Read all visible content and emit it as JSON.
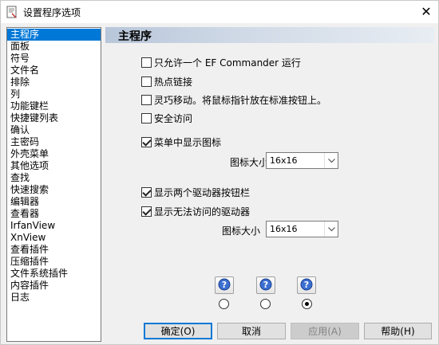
{
  "window": {
    "title": "设置程序选项",
    "icon": "settings-doc-icon"
  },
  "sidebar": {
    "items": [
      {
        "label": "主程序",
        "selected": true
      },
      {
        "label": "面板"
      },
      {
        "label": "符号"
      },
      {
        "label": "文件名"
      },
      {
        "label": "排除"
      },
      {
        "label": "列"
      },
      {
        "label": "功能键栏"
      },
      {
        "label": "快捷键列表"
      },
      {
        "label": "确认"
      },
      {
        "label": "主密码"
      },
      {
        "label": "外壳菜单"
      },
      {
        "label": "其他选项"
      },
      {
        "label": "查找"
      },
      {
        "label": "快速搜索"
      },
      {
        "label": "编辑器"
      },
      {
        "label": "查看器"
      },
      {
        "label": "IrfanView"
      },
      {
        "label": "XnView"
      },
      {
        "label": "查看插件"
      },
      {
        "label": "压缩插件"
      },
      {
        "label": "文件系统插件"
      },
      {
        "label": "内容插件"
      },
      {
        "label": "日志"
      }
    ]
  },
  "main": {
    "header": "主程序",
    "options": {
      "single_instance": {
        "label": "只允许一个 EF Commander 运行",
        "checked": false
      },
      "hotlink": {
        "label": "热点链接",
        "checked": false
      },
      "smart_move": {
        "label": "灵巧移动。将鼠标指针放在标准按钮上。",
        "checked": false
      },
      "safe_access": {
        "label": "安全访问",
        "checked": false
      },
      "menu_icons": {
        "label": "菜单中显示图标",
        "checked": true
      },
      "two_drive_bars": {
        "label": "显示两个驱动器按钮栏",
        "checked": true
      },
      "show_inaccessible": {
        "label": "显示无法访问的驱动器",
        "checked": true
      }
    },
    "icon_size_label_1": "图标大小",
    "icon_size_value_1": "16x16",
    "icon_size_label_2": "图标大小",
    "icon_size_value_2": "16x16",
    "help_icons": [
      "help-icon",
      "help-icon",
      "help-icon"
    ],
    "radio_selected_index": 2
  },
  "buttons": {
    "ok": "确定(O)",
    "cancel": "取消",
    "apply": "应用(A)",
    "help": "帮助(H)"
  },
  "colors": {
    "selection": "#0078d7",
    "header_gradient_start": "#b8c6da",
    "header_gradient_end": "#e8edf3"
  }
}
